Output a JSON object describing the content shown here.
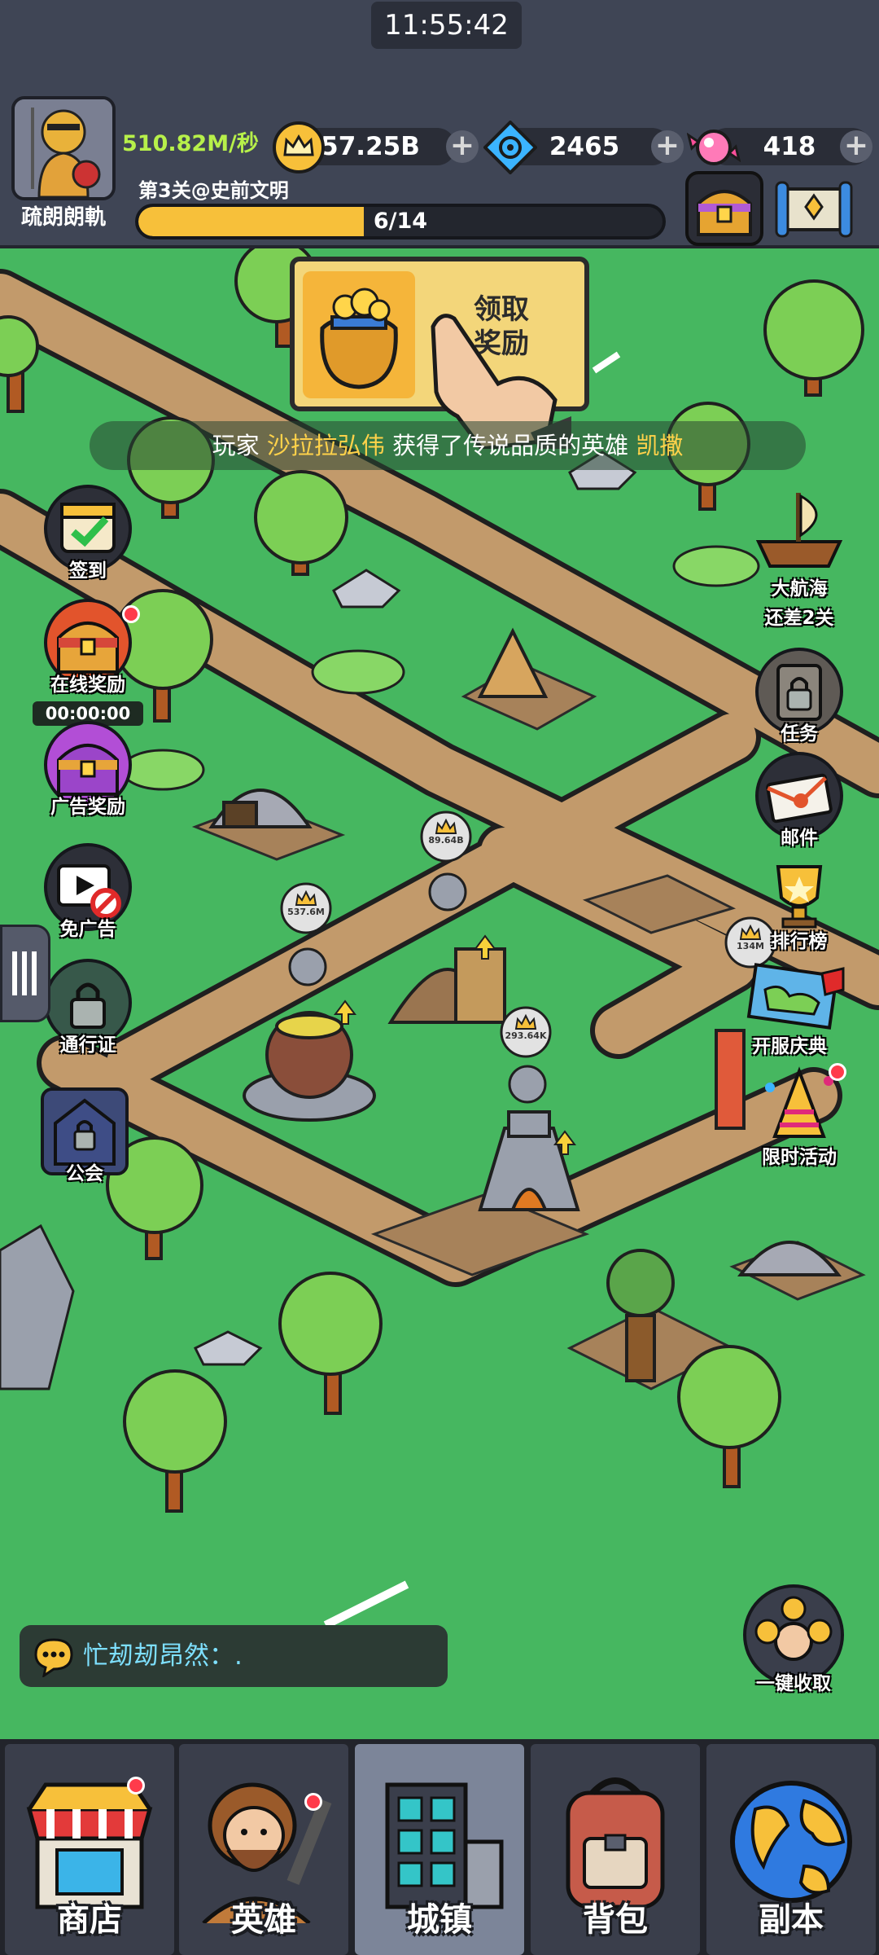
{
  "status_bar": {
    "time": "11:55:42"
  },
  "player": {
    "name": "疏朗朗軌",
    "income": "510.82M/秒"
  },
  "resources": {
    "gold": "57.25B",
    "gems": "2465",
    "candy": "418"
  },
  "stage": {
    "label": "第3关@史前文明",
    "progress_text": "6/14",
    "progress": 0.43
  },
  "promo": {
    "line1": "领取",
    "line2": "奖励"
  },
  "ticker": {
    "prefix": "玩家",
    "player": "沙拉拉弘伟",
    "middle": "获得了传说品质的英雄",
    "hero": "凯撒"
  },
  "left_buttons": {
    "signin": "签到",
    "online_reward": "在线奖励",
    "online_timer": "00:00:00",
    "ad_reward": "广告奖励",
    "no_ads": "免广告",
    "pass": "通行证",
    "guild": "公会"
  },
  "right_buttons": {
    "voyage_title": "大航海",
    "voyage_sub": "还差2关",
    "tasks": "任务",
    "mail": "邮件",
    "ranking": "排行榜",
    "server_event": "开服庆典",
    "limited_event": "限时活动",
    "collect_all": "一键收取"
  },
  "map_bubbles": {
    "b1": "89.64B",
    "b2": "537.6M",
    "b3": "293.64K",
    "b4": "134M"
  },
  "chat": {
    "text": "忙刼刼昂然：."
  },
  "bottom_nav": {
    "shop": "商店",
    "heroes": "英雄",
    "town": "城镇",
    "bag": "背包",
    "dungeon": "副本"
  },
  "colors": {
    "grass": "#46b760",
    "path": "#c29a6b",
    "gold": "#f7c03a",
    "income_green": "#b7f04a",
    "alert_red": "#ff3b4b"
  }
}
